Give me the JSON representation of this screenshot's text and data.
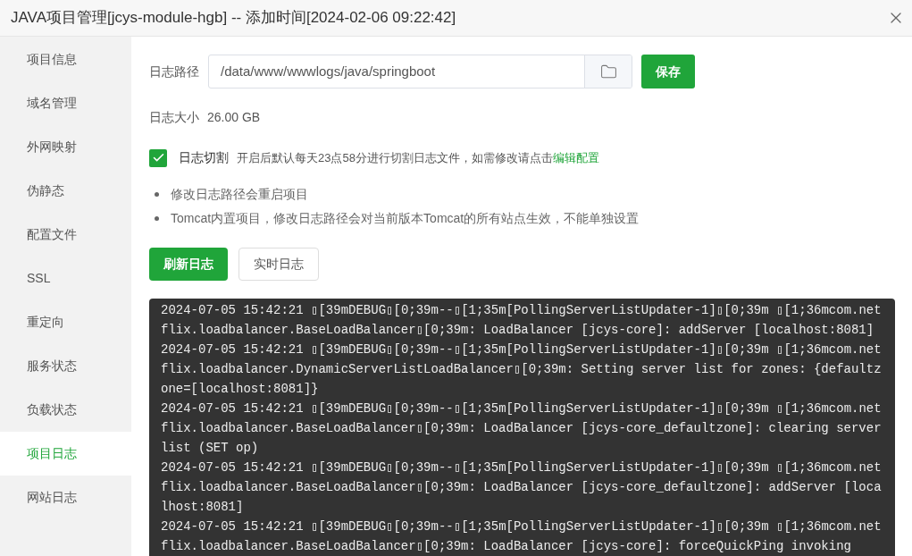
{
  "window": {
    "title": "JAVA项目管理[jcys-module-hgb] -- 添加时间[2024-02-06 09:22:42]"
  },
  "sidebar": {
    "items": [
      {
        "label": "项目信息",
        "selected": false
      },
      {
        "label": "域名管理",
        "selected": false
      },
      {
        "label": "外网映射",
        "selected": false
      },
      {
        "label": "伪静态",
        "selected": false
      },
      {
        "label": "配置文件",
        "selected": false
      },
      {
        "label": "SSL",
        "selected": false
      },
      {
        "label": "重定向",
        "selected": false
      },
      {
        "label": "服务状态",
        "selected": false
      },
      {
        "label": "负载状态",
        "selected": false
      },
      {
        "label": "项目日志",
        "selected": true
      },
      {
        "label": "网站日志",
        "selected": false
      }
    ]
  },
  "log_path": {
    "label": "日志路径",
    "value": "/data/www/wwwlogs/java/springboot",
    "save_button": "保存"
  },
  "log_size": {
    "label": "日志大小",
    "value": "26.00 GB"
  },
  "log_rotate": {
    "checked": true,
    "label": "日志切割",
    "description": "开启后默认每天23点58分进行切割日志文件，如需修改请点击",
    "link": "编辑配置"
  },
  "notes": [
    "修改日志路径会重启项目",
    "Tomcat内置项目，修改日志路径会对当前版本Tomcat的所有站点生效，不能单独设置"
  ],
  "buttons": [
    {
      "label": "刷新日志",
      "kind": "primary"
    },
    {
      "label": "实时日志",
      "kind": "secondary"
    }
  ],
  "log_lines": [
    "2024-07-05 15:42:21 ▯[39mDEBUG▯[0;39m--▯[1;35m[PollingServerListUpdater-1]▯[0;39m ▯[1;36mcom.netflix.loadbalancer.BaseLoadBalancer▯[0;39m: LoadBalancer [jcys-core]: addServer [localhost:8081]",
    "2024-07-05 15:42:21 ▯[39mDEBUG▯[0;39m--▯[1;35m[PollingServerListUpdater-1]▯[0;39m ▯[1;36mcom.netflix.loadbalancer.DynamicServerListLoadBalancer▯[0;39m: Setting server list for zones: {defaultzone=[localhost:8081]}",
    "2024-07-05 15:42:21 ▯[39mDEBUG▯[0;39m--▯[1;35m[PollingServerListUpdater-1]▯[0;39m ▯[1;36mcom.netflix.loadbalancer.BaseLoadBalancer▯[0;39m: LoadBalancer [jcys-core_defaultzone]: clearing server list (SET op)",
    "2024-07-05 15:42:21 ▯[39mDEBUG▯[0;39m--▯[1;35m[PollingServerListUpdater-1]▯[0;39m ▯[1;36mcom.netflix.loadbalancer.BaseLoadBalancer▯[0;39m: LoadBalancer [jcys-core_defaultzone]: addServer [localhost:8081]",
    "2024-07-05 15:42:21 ▯[39mDEBUG▯[0;39m--▯[1;35m[PollingServerListUpdater-1]▯[0;39m ▯[1;36mcom.netflix.loadbalancer.BaseLoadBalancer▯[0;39m: LoadBalancer [jcys-core]: forceQuickPing invoking"
  ]
}
